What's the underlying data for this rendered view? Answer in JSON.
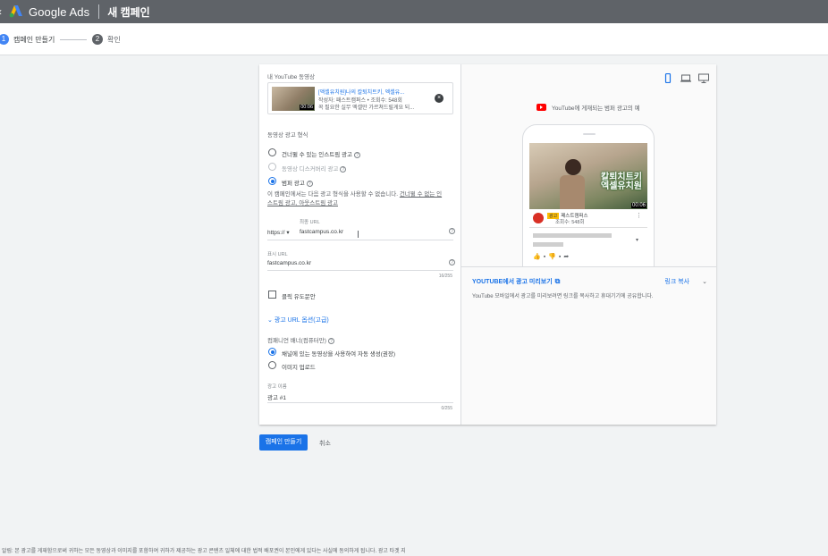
{
  "app": {
    "brand": "Google Ads",
    "page_title": "새 캠페인"
  },
  "stepper": [
    {
      "num": "1",
      "label": "캠페인 만들기",
      "color": "#4285f4"
    },
    {
      "num": "2",
      "label": "확인",
      "color": "#5f6368"
    }
  ],
  "form": {
    "video_section_label": "내 YouTube 동영상",
    "video": {
      "title": "[액셀유치원]나의 칼퇴치트키, 엑셀유...",
      "meta": "작성자: 패스트캠퍼스 • 조회수: 548회",
      "desc": "꼭 필요한 실무 엑셀만 가르쳐드릴게요 되...",
      "duration": "00:06"
    },
    "format_label": "동영상 광고 형식",
    "formats": [
      {
        "label": "건너뛸 수 있는 인스트림 광고",
        "state": "unselected"
      },
      {
        "label": "동영상 디스커버리 광고",
        "state": "disabled"
      },
      {
        "label": "범퍼 광고",
        "state": "selected"
      }
    ],
    "format_note_prefix": "이 캠페인에서는 다음 광고 형식을 사용할 수 없습니다.",
    "format_note_link1": "건너뛸 수 없는 인",
    "format_note_link2": "스트림 광고, 아웃스트림 광고",
    "final_url_label": "최종 URL",
    "protocol": "https://",
    "final_url_value": "fastcampus.co.kr",
    "display_url_label": "표시 URL",
    "display_url_value": "fastcampus.co.kr",
    "display_url_counter": "16/255",
    "cta_label": "클릭 유도문안",
    "url_options_label": "광고 URL 옵션(고급)",
    "companion_label": "컴패니언 배너(컴퓨터만)",
    "companion_options": [
      {
        "label": "채널에 있는 동영상을 사용하여 자동 생성(권장)",
        "state": "selected"
      },
      {
        "label": "이미지 업로드",
        "state": "unselected"
      }
    ],
    "ad_name_label": "광고 이름",
    "ad_name_value": "광고 #1",
    "ad_name_counter": "0/255"
  },
  "preview": {
    "caption": "YouTube에 게재되는 범퍼 광고의 예",
    "overlay_text_line1": "칼퇴치트키",
    "overlay_text_line2": "엑셀유치원",
    "duration": "00:06",
    "ad_badge": "광고",
    "channel": "패스트캠퍼스",
    "views": "조회수: 548회",
    "youtube_preview_label": "YOUTUBE에서 광고 미리보기",
    "link_share_label": "링크 복사",
    "share_note": "YouTube 모바일에서 광고를 미리보려면 링크를 복사하고 휴대기기에 공유합니다."
  },
  "actions": {
    "create": "캠페인 만들기",
    "cancel": "취소"
  },
  "footer": "알림: 본 광고를 게재함으로써 귀하는 모든 동영상과 이미지를 포함하여 귀하가 제공하는 광고 콘텐츠 일체에 대한 법적 배포권이 본인에게 있다는 사실에 동의하게 됩니다. 광고 타겟 지",
  "colors": {
    "accent": "#1a73e8",
    "topbar": "#5f6368",
    "youtube_red": "#ff0000"
  }
}
